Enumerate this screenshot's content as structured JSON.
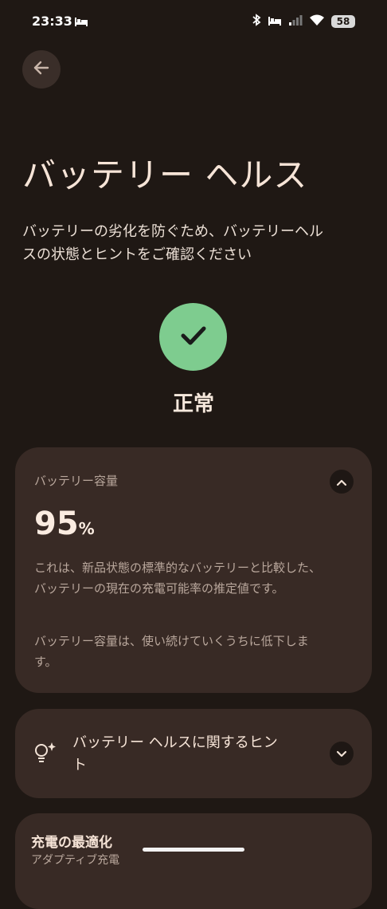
{
  "status_bar": {
    "time": "23:33",
    "battery_level": "58",
    "icons": [
      "bed-icon",
      "bluetooth-icon",
      "bed-icon",
      "signal-icon",
      "wifi-icon",
      "battery-icon"
    ]
  },
  "header": {
    "back_icon": "arrow-left-icon",
    "title": "バッテリー ヘルス",
    "description": "バッテリーの劣化を防ぐため、バッテリーヘルスの状態とヒントをご確認ください"
  },
  "health": {
    "icon": "check-icon",
    "status": "正常"
  },
  "capacity_card": {
    "label": "バッテリー容量",
    "value": "95",
    "unit": "%",
    "description_1": "これは、新品状態の標準的なバッテリーと比較した、バッテリーの現在の充電可能率の推定値です。",
    "description_2": "バッテリー容量は、使い続けていくうちに低下します。",
    "toggle_icon": "chevron-up-icon"
  },
  "tips_card": {
    "icon": "lightbulb-icon",
    "title": "バッテリー ヘルスに関するヒント",
    "toggle_icon": "chevron-down-icon"
  },
  "optimize_card": {
    "title": "充電の最適化",
    "subtitle": "アダプティブ充電"
  },
  "colors": {
    "background": "#1f1814",
    "card": "#382a25",
    "status_ok": "#7ecc8f"
  }
}
